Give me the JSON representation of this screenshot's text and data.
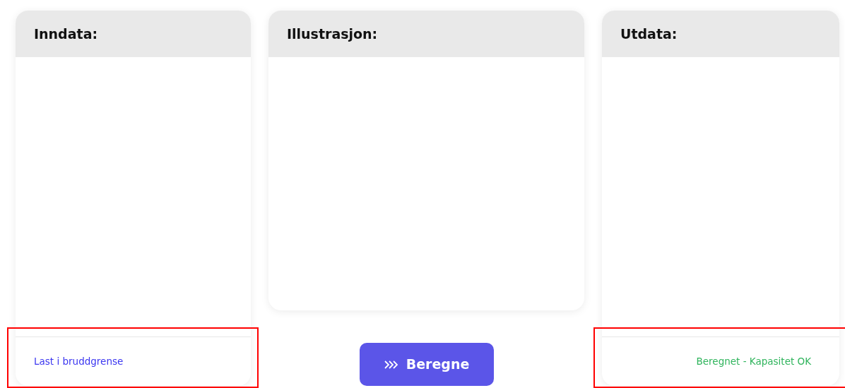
{
  "panels": [
    {
      "title": "Inndata:",
      "footer": {
        "text": "Last i bruddgrense",
        "color": "#3b36f0",
        "highlighted": true
      }
    },
    {
      "title": "Illustrasjon:"
    },
    {
      "title": "Utdata:",
      "footer": {
        "text": "Beregnet - Kapasitet OK",
        "color": "#2fb45c",
        "highlighted": true
      }
    }
  ],
  "action_button": {
    "label": "Beregne"
  }
}
